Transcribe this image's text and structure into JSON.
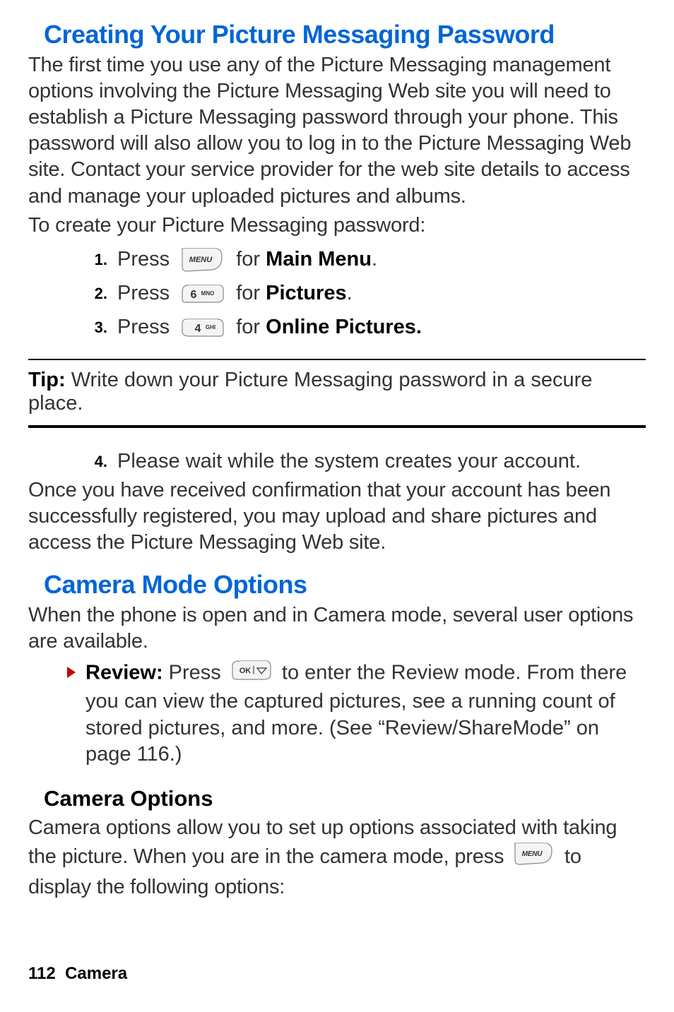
{
  "section1": {
    "title": "Creating Your Picture Messaging Password",
    "para1": "The first time you use any of the Picture Messaging management options involving the Picture Messaging Web site you will need to establish a Picture Messaging password through your phone. This password will also allow you to log in to the Picture Messaging Web site. Contact your service provider for the web site details to access and manage your uploaded pictures and albums.",
    "para2": "To create your Picture Messaging password:",
    "steps": {
      "s1": {
        "num": "1.",
        "pre": "Press ",
        "post_for": " for ",
        "target": "Main Menu",
        "dot": "."
      },
      "s2": {
        "num": "2.",
        "pre": "Press ",
        "post_for": " for ",
        "target": "Pictures",
        "dot": "."
      },
      "s3": {
        "num": "3.",
        "pre": "Press ",
        "post_for": " for ",
        "target": "Online Pictures.",
        "dot": ""
      }
    },
    "tip": {
      "label": "Tip: ",
      "text": "Write down your Picture Messaging password in a secure place."
    },
    "step4": {
      "num": "4.",
      "text": "Please wait while the system creates your account."
    },
    "para3": "Once you have received confirmation that your account has been successfully registered, you may upload and share pictures and access the Picture Messaging Web site."
  },
  "section2": {
    "title": "Camera Mode Options",
    "para1": "When the phone is open and in Camera mode, several user options are available.",
    "bullet": {
      "label": "Review: ",
      "pre": "Press ",
      "post": " to enter the Review mode. From there you can view the captured pictures, see a running count of stored pictures, and more. (See “Review/ShareMode” on page 116.)"
    }
  },
  "section3": {
    "title": "Camera Options",
    "para_pre": "Camera options allow you to set up options associated with taking the picture. When you are in the camera mode, press ",
    "para_post": " to display the following options:"
  },
  "footer": {
    "page": "112",
    "label": "Camera"
  },
  "icons": {
    "menu": "MENU",
    "six": "6",
    "mno": "MNO",
    "four": "4",
    "ghi": "GHI",
    "ok": "OK"
  }
}
